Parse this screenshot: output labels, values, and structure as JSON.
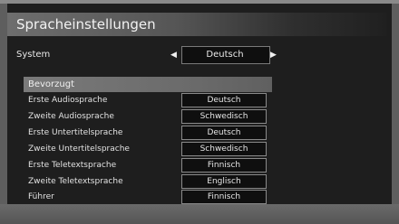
{
  "menu": {
    "title": "Spracheinstellungen",
    "system": {
      "label": "System",
      "value": "Deutsch"
    },
    "preferred": {
      "header": "Bevorzugt",
      "rows": [
        {
          "label": "Erste Audiosprache",
          "value": "Deutsch"
        },
        {
          "label": "Zweite Audiosprache",
          "value": "Schwedisch"
        },
        {
          "label": "Erste Untertitelsprache",
          "value": "Deutsch"
        },
        {
          "label": "Zweite Untertitelsprache",
          "value": "Schwedisch"
        },
        {
          "label": "Erste Teletextsprache",
          "value": "Finnisch"
        },
        {
          "label": "Zweite Teletextsprache",
          "value": "Englisch"
        },
        {
          "label": "Führer",
          "value": "Finnisch"
        }
      ]
    }
  },
  "colors": {
    "panel_background": "#1e1e1e",
    "title_bar_light": "#6e6e6e",
    "header_bar": "#7a7a7a",
    "value_box_border": "#8a8a8a",
    "text": "#e8e8e8"
  },
  "icons": {
    "left": "arrow-left-icon",
    "right": "arrow-right-icon"
  }
}
